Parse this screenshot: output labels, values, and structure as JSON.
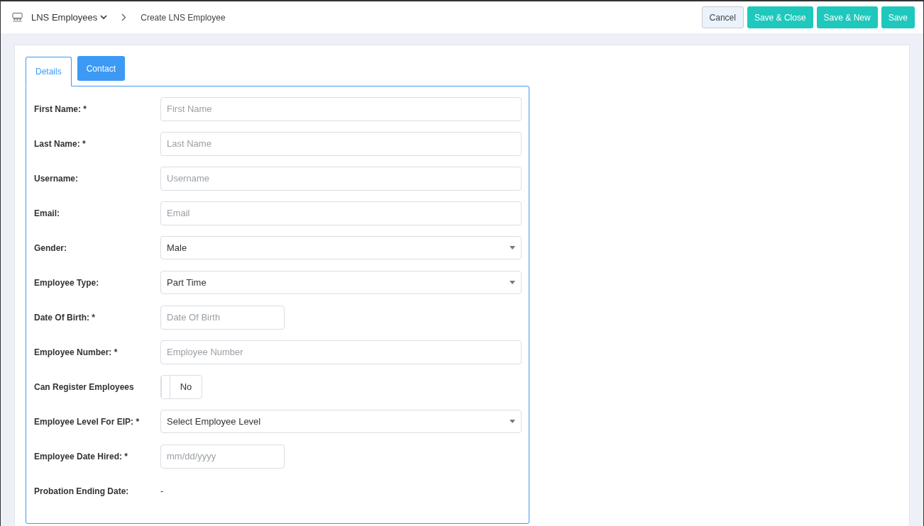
{
  "breadcrumb": {
    "parent": "LNS Employees",
    "current": "Create LNS Employee"
  },
  "actions": [
    {
      "label": "Cancel",
      "kind": "secondary"
    },
    {
      "label": "Save & Close",
      "kind": "primary"
    },
    {
      "label": "Save & New",
      "kind": "primary"
    },
    {
      "label": "Save",
      "kind": "primary"
    }
  ],
  "tabs": [
    {
      "label": "Details",
      "selected": true
    },
    {
      "label": "Contact",
      "selected": false
    }
  ],
  "fields": [
    {
      "label": "First Name: *",
      "kind": "text",
      "placeholder": "First Name"
    },
    {
      "label": "Last Name: *",
      "kind": "text",
      "placeholder": "Last Name"
    },
    {
      "label": "Username:",
      "kind": "text",
      "placeholder": "Username"
    },
    {
      "label": "Email:",
      "kind": "text",
      "placeholder": "Email"
    },
    {
      "label": "Gender:",
      "kind": "select",
      "value": "Male"
    },
    {
      "label": "Employee Type:",
      "kind": "select",
      "value": "Part Time"
    },
    {
      "label": "Date Of Birth: *",
      "kind": "date",
      "placeholder": "Date Of Birth"
    },
    {
      "label": "Employee Number: *",
      "kind": "text",
      "placeholder": "Employee Number"
    },
    {
      "label": "Can Register Employees",
      "kind": "toggle",
      "on": false,
      "value": "No"
    },
    {
      "label": "Employee Level For EIP: *",
      "kind": "select",
      "value": "Select Employee Level"
    },
    {
      "label": "Employee Date Hired: *",
      "kind": "date",
      "placeholder": "mm/dd/yyyy"
    },
    {
      "label": "Probation Ending Date:",
      "kind": "static",
      "value": "-"
    }
  ]
}
